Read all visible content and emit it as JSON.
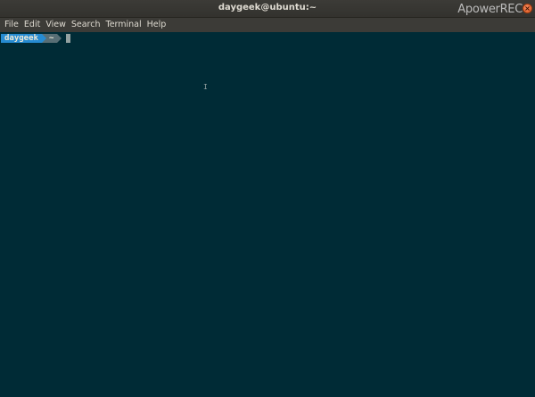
{
  "window": {
    "title": "daygeek@ubuntu:~",
    "watermark": "ApowerREC",
    "close_glyph": "×"
  },
  "menubar": {
    "items": [
      "File",
      "Edit",
      "View",
      "Search",
      "Terminal",
      "Help"
    ]
  },
  "terminal": {
    "prompt_user": "daygeek",
    "prompt_dir": "~",
    "mouse_pointer_glyph": "I"
  },
  "colors": {
    "background": "#002b36",
    "prompt_user_bg": "#268bd2",
    "prompt_dir_bg": "#586e75",
    "titlebar": "#3c3b37"
  }
}
